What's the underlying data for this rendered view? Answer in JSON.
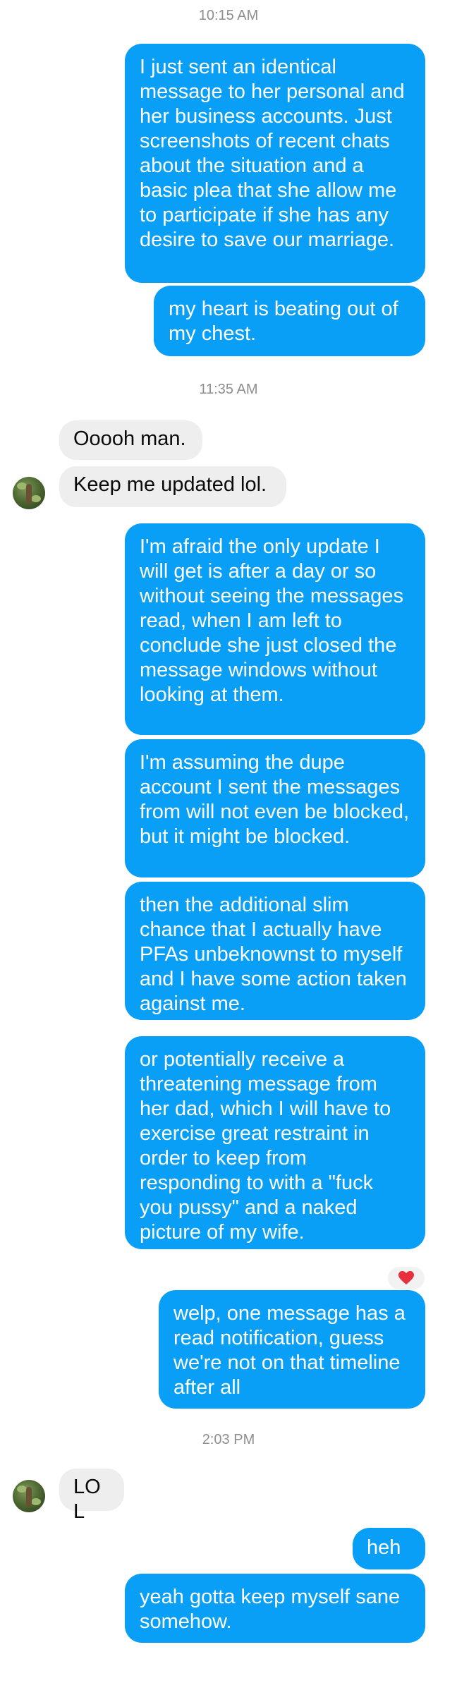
{
  "conversation": {
    "timestamps": [
      "10:15 AM",
      "11:35 AM",
      "2:03 PM"
    ],
    "messages": [
      {
        "from": "me",
        "text": "I just sent an identical message to her personal and her business accounts. Just screenshots of recent chats about the situation and a basic plea that she allow me to participate if she has any desire to save our marriage."
      },
      {
        "from": "me",
        "text": "my heart is beating out of my chest."
      },
      {
        "from": "them",
        "text": "Ooooh man."
      },
      {
        "from": "them",
        "text": "Keep me updated lol."
      },
      {
        "from": "me",
        "text": "I'm afraid the only update I will get is after a day or so without seeing the messages read, when I am left to conclude she just closed the message windows without looking at them."
      },
      {
        "from": "me",
        "text": "I'm assuming the dupe account I sent the messages from will not even be blocked, but it might be blocked."
      },
      {
        "from": "me",
        "text": "then the additional slim chance that I actually have PFAs unbeknownst to myself and I have some action taken against me."
      },
      {
        "from": "me",
        "text": "or potentially receive a threatening message from her dad, which I will have to exercise great restraint in order to keep from responding to with a \"fuck you pussy\" and a naked picture of my wife."
      },
      {
        "from": "me",
        "text": "welp, one message has a read notification, guess we're not on that timeline after all"
      },
      {
        "from": "them",
        "text": "LOL"
      },
      {
        "from": "me",
        "text": "heh"
      },
      {
        "from": "me",
        "text": "yeah gotta keep myself sane somehow."
      }
    ],
    "reaction": {
      "icon": "heart-icon",
      "color": "#e8303c"
    },
    "colors": {
      "outgoing_bubble": "#0a9ff6",
      "incoming_bubble": "#eeeeee",
      "timestamp": "#8e8e8e"
    }
  }
}
